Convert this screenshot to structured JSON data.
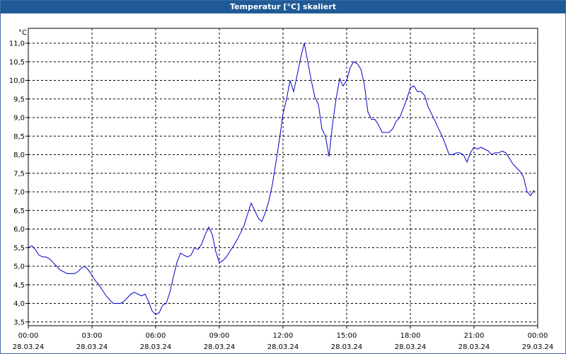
{
  "window": {
    "title": "Temperatur [°C] skaliert"
  },
  "colors": {
    "titlebar": "#1f5a96",
    "line": "#0000c8",
    "grid": "#000000",
    "background": "#ffffff"
  },
  "chart_data": {
    "type": "line",
    "title": "Temperatur [°C] skaliert",
    "ylabel": "°C",
    "xlabel": "",
    "ylim": [
      3.4,
      11.4
    ],
    "xlim": [
      0,
      24
    ],
    "grid": true,
    "y_ticks": [
      "3,5",
      "4,0",
      "4,5",
      "5,0",
      "5,5",
      "6,0",
      "6,5",
      "7,0",
      "7,5",
      "8,0",
      "8,5",
      "9,0",
      "9,5",
      "10,0",
      "10,5",
      "11,0"
    ],
    "y_tick_values": [
      3.5,
      4.0,
      4.5,
      5.0,
      5.5,
      6.0,
      6.5,
      7.0,
      7.5,
      8.0,
      8.5,
      9.0,
      9.5,
      10.0,
      10.5,
      11.0
    ],
    "x_ticks": [
      {
        "time": "00:00",
        "date": "28.03.24",
        "hour": 0
      },
      {
        "time": "03:00",
        "date": "28.03.24",
        "hour": 3
      },
      {
        "time": "06:00",
        "date": "28.03.24",
        "hour": 6
      },
      {
        "time": "09:00",
        "date": "28.03.24",
        "hour": 9
      },
      {
        "time": "12:00",
        "date": "28.03.24",
        "hour": 12
      },
      {
        "time": "15:00",
        "date": "28.03.24",
        "hour": 15
      },
      {
        "time": "18:00",
        "date": "28.03.24",
        "hour": 18
      },
      {
        "time": "21:00",
        "date": "28.03.24",
        "hour": 21
      },
      {
        "time": "00:00",
        "date": "29.03.24",
        "hour": 24
      }
    ],
    "series": [
      {
        "x": [
          0,
          0.17,
          0.33,
          0.5,
          0.67,
          0.83,
          1.0,
          1.17,
          1.33,
          1.5,
          1.67,
          1.83,
          2.0,
          2.17,
          2.33,
          2.5,
          2.67,
          2.83,
          3.0,
          3.17,
          3.33,
          3.5,
          3.67,
          3.83,
          4.0,
          4.17,
          4.33,
          4.5,
          4.67,
          4.83,
          5.0,
          5.17,
          5.33,
          5.5,
          5.67,
          5.83,
          6.0,
          6.17,
          6.33,
          6.5,
          6.67,
          6.83,
          7.0,
          7.17,
          7.33,
          7.5,
          7.67,
          7.83,
          8.0,
          8.17,
          8.33,
          8.5,
          8.67,
          8.83,
          9.0,
          9.17,
          9.33,
          9.5,
          9.67,
          9.83,
          10.0,
          10.17,
          10.33,
          10.5,
          10.67,
          10.83,
          11.0,
          11.17,
          11.33,
          11.5,
          11.67,
          11.83,
          12.0,
          12.17,
          12.33,
          12.5,
          12.67,
          12.83,
          13.0,
          13.17,
          13.33,
          13.5,
          13.67,
          13.83,
          14.0,
          14.17,
          14.33,
          14.5,
          14.67,
          14.83,
          15.0,
          15.17,
          15.33,
          15.5,
          15.67,
          15.83,
          16.0,
          16.17,
          16.33,
          16.5,
          16.67,
          16.83,
          17.0,
          17.17,
          17.33,
          17.5,
          17.67,
          17.83,
          18.0,
          18.17,
          18.33,
          18.5,
          18.67,
          18.83,
          19.0,
          19.17,
          19.33,
          19.5,
          19.67,
          19.83,
          20.0,
          20.17,
          20.33,
          20.5,
          20.67,
          20.83,
          21.0,
          21.17,
          21.33,
          21.5,
          21.67,
          21.83,
          22.0,
          22.17,
          22.33,
          22.5,
          22.67,
          22.83,
          23.0,
          23.17,
          23.33,
          23.5,
          23.67,
          23.83
        ],
        "values": [
          5.5,
          5.55,
          5.45,
          5.3,
          5.25,
          5.25,
          5.2,
          5.1,
          5.0,
          4.9,
          4.85,
          4.8,
          4.8,
          4.8,
          4.85,
          4.95,
          5.0,
          4.9,
          4.75,
          4.6,
          4.5,
          4.35,
          4.2,
          4.1,
          4.0,
          4.0,
          4.0,
          4.05,
          4.15,
          4.25,
          4.3,
          4.25,
          4.2,
          4.25,
          4.05,
          3.8,
          3.7,
          3.75,
          3.95,
          4.0,
          4.3,
          4.7,
          5.1,
          5.35,
          5.3,
          5.25,
          5.3,
          5.5,
          5.45,
          5.6,
          5.85,
          6.05,
          5.85,
          5.4,
          5.1,
          5.15,
          5.25,
          5.4,
          5.55,
          5.7,
          5.9,
          6.1,
          6.4,
          6.7,
          6.5,
          6.3,
          6.2,
          6.45,
          6.75,
          7.2,
          7.8,
          8.4,
          9.1,
          9.5,
          10.0,
          9.7,
          10.15,
          10.6,
          11.0,
          10.5,
          10.0,
          9.55,
          9.35,
          8.7,
          8.5,
          7.95,
          8.8,
          9.5,
          10.05,
          9.85,
          10.0,
          10.35,
          10.5,
          10.45,
          10.3,
          9.9,
          9.15,
          8.95,
          8.95,
          8.8,
          8.6,
          8.6,
          8.6,
          8.7,
          8.9,
          9.0,
          9.25,
          9.5,
          9.8,
          9.85,
          9.7,
          9.7,
          9.6,
          9.3,
          9.1,
          8.9,
          8.7,
          8.5,
          8.25,
          8.0,
          8.0,
          8.05,
          8.05,
          8.0,
          7.8,
          8.05,
          8.2,
          8.15,
          8.2,
          8.15,
          8.1,
          8.0,
          8.05,
          8.05,
          8.1,
          8.05,
          7.9,
          7.75,
          7.65,
          7.55,
          7.4,
          7.0,
          6.9,
          7.05
        ]
      }
    ]
  }
}
